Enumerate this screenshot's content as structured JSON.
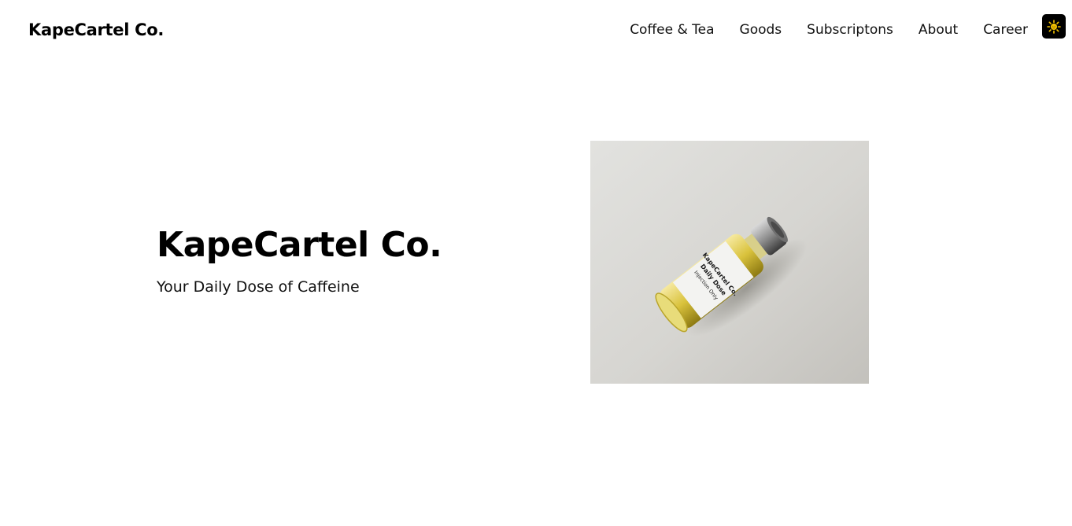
{
  "header": {
    "brand": "KapeCartel Co.",
    "nav": [
      {
        "label": "Coffee & Tea"
      },
      {
        "label": "Goods"
      },
      {
        "label": "Subscriptons"
      },
      {
        "label": "About"
      },
      {
        "label": "Career"
      }
    ],
    "theme_toggle": {
      "icon": "sun-icon"
    }
  },
  "hero": {
    "title": "KapeCartel Co.",
    "subtitle": "Your Daily Dose of Caffeine",
    "image": {
      "icon": "product-vial-photo",
      "label_lines": [
        "KapeCartel Co.",
        "Daily Dose",
        "Injection Only"
      ]
    }
  },
  "colors": {
    "accent_icon": "#f5c400",
    "toggle_bg": "#000000",
    "text": "#111111"
  }
}
